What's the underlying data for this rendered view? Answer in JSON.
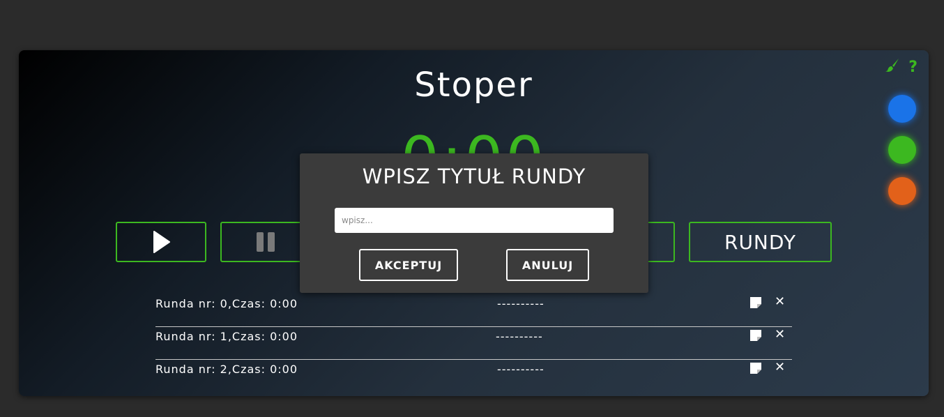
{
  "app": {
    "title": "Stoper",
    "timer": "0:00"
  },
  "colors": {
    "accent": "#3cb820",
    "theme_blue": "#1a73e8",
    "theme_green": "#3cb820",
    "theme_orange": "#e2611a"
  },
  "top_icons": {
    "brush": "paint-brush-icon",
    "help": "help-icon",
    "help_glyph": "?"
  },
  "controls": {
    "play_icon": "play-icon",
    "pause_icon": "pause-icon",
    "rounds_label": "RUNDY"
  },
  "rounds": [
    {
      "label": "Runda nr: 0,Czas: 0:00",
      "title": "----------"
    },
    {
      "label": "Runda nr: 1,Czas: 0:00",
      "title": "----------"
    },
    {
      "label": "Runda nr: 2,Czas: 0:00",
      "title": "----------"
    }
  ],
  "modal": {
    "title": "WPISZ TYTUŁ RUNDY",
    "input_placeholder": "wpisz...",
    "input_value": "",
    "accept_label": "AKCEPTUJ",
    "cancel_label": "ANULUJ"
  }
}
